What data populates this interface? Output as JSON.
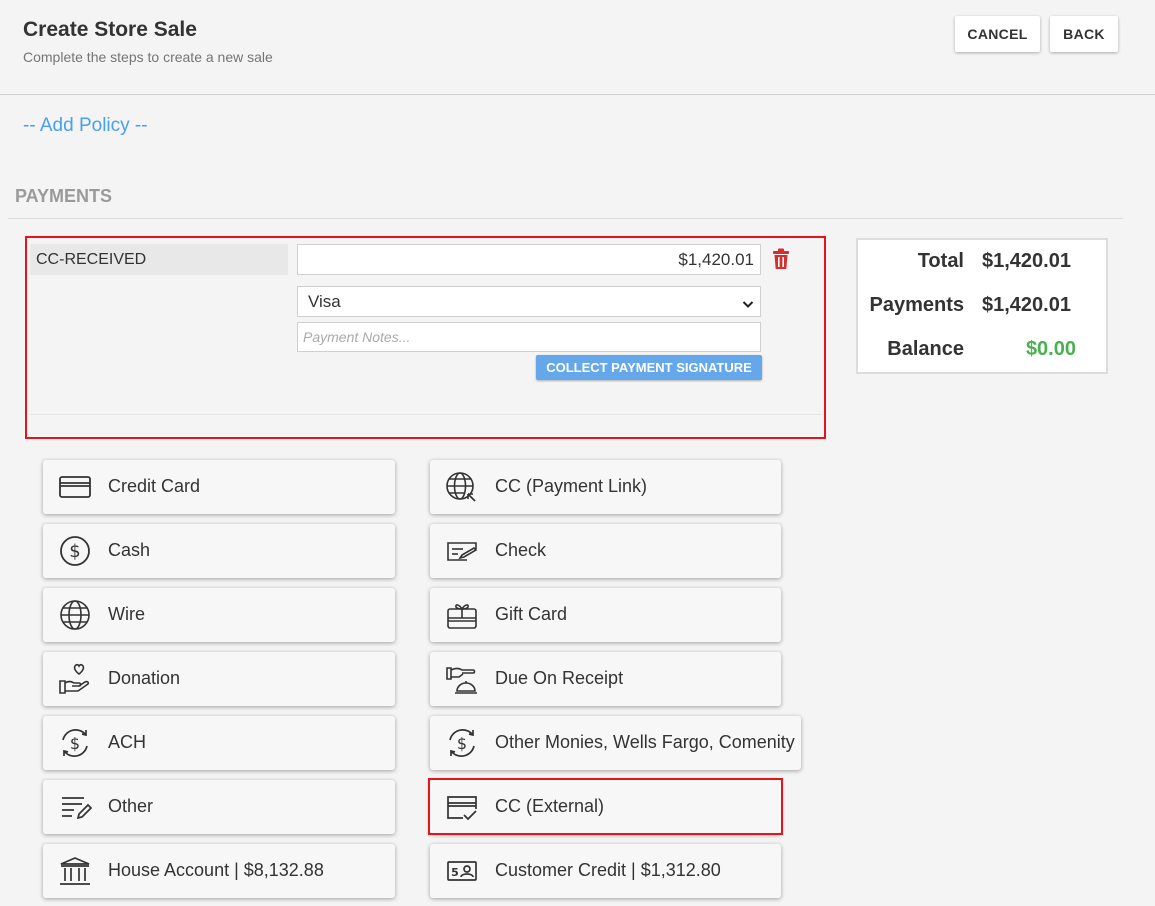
{
  "header": {
    "title": "Create Store Sale",
    "subtitle": "Complete the steps to create a new sale",
    "cancel_label": "CANCEL",
    "back_label": "BACK"
  },
  "add_policy_label": "-- Add Policy --",
  "payments_section_title": "PAYMENTS",
  "payment_entry": {
    "type_label": "CC-RECEIVED",
    "amount": "$1,420.01",
    "card_type": "Visa",
    "notes_placeholder": "Payment Notes...",
    "signature_button_label": "COLLECT PAYMENT SIGNATURE"
  },
  "totals": {
    "total_label": "Total",
    "total_value": "$1,420.01",
    "payments_label": "Payments",
    "payments_value": "$1,420.01",
    "balance_label": "Balance",
    "balance_value": "$0.00"
  },
  "payment_methods": [
    {
      "label": "Credit Card",
      "icon": "credit-card-icon"
    },
    {
      "label": "CC (Payment Link)",
      "icon": "globe-link-icon"
    },
    {
      "label": "Cash",
      "icon": "dollar-circle-icon"
    },
    {
      "label": "Check",
      "icon": "check-icon"
    },
    {
      "label": "Wire",
      "icon": "globe-icon"
    },
    {
      "label": "Gift Card",
      "icon": "gift-card-icon"
    },
    {
      "label": "Donation",
      "icon": "donation-hand-icon"
    },
    {
      "label": "Due On Receipt",
      "icon": "hand-bell-icon"
    },
    {
      "label": "ACH",
      "icon": "dollar-refresh-icon"
    },
    {
      "label": "Other Monies, Wells Fargo, Comenity",
      "icon": "dollar-refresh-icon"
    },
    {
      "label": "Other",
      "icon": "list-pencil-icon"
    },
    {
      "label": "CC (External)",
      "icon": "card-check-icon"
    },
    {
      "label": "House Account | $8,132.88",
      "icon": "bank-icon"
    },
    {
      "label": "Customer Credit | $1,312.80",
      "icon": "id-card-icon"
    }
  ],
  "colors": {
    "accent_link": "#49a0ec",
    "highlight_border": "#e3151a",
    "balance_green": "#4caf50",
    "signature_button": "#64a7eb",
    "trash_red": "#d32f2f"
  }
}
